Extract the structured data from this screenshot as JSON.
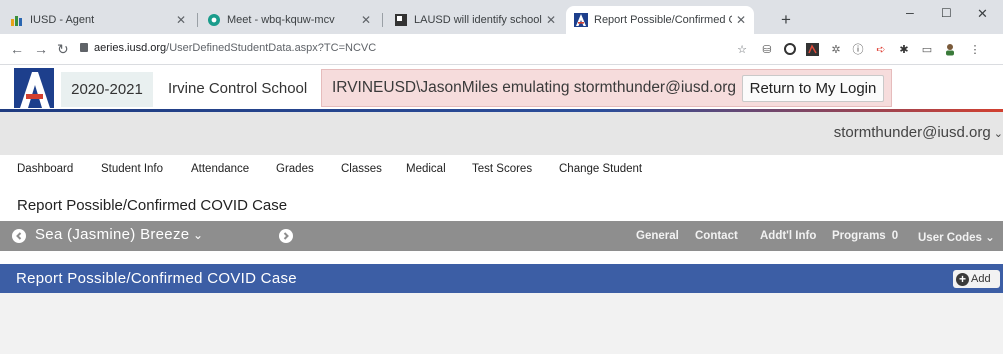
{
  "browser": {
    "tabs": [
      {
        "title": "IUSD - Agent",
        "favicon": "iusd-agent-icon",
        "active": false
      },
      {
        "title": "Meet - wbq-kquw-mcv",
        "favicon": "meet-icon",
        "active": false
      },
      {
        "title": "LAUSD will identify schools, class",
        "favicon": "news-icon",
        "active": false
      },
      {
        "title": "Report Possible/Confirmed COVI",
        "favicon": "aeries-icon",
        "active": true
      }
    ],
    "url_host": "aeries.iusd.org",
    "url_path": "/UserDefinedStudentData.aspx?TC=NCVC",
    "colors": {
      "tabstrip": "#dee1e6",
      "toolbar": "#ffffff"
    }
  },
  "header": {
    "school_year": "2020-2021",
    "school_name": "Irvine Control School",
    "emulating_text": "IRVINEUSD\\JasonMiles emulating stormthunder@iusd.org",
    "return_button": "Return to My Login",
    "user_email": "stormthunder@iusd.org",
    "colors": {
      "logo": "#1d3f8c",
      "emulating_bg": "#f6dcdc",
      "accent_red": "#d24030"
    }
  },
  "main_nav": {
    "items": [
      "Dashboard",
      "Student Info",
      "Attendance",
      "Grades",
      "Classes",
      "Medical",
      "Test Scores",
      "Change Student"
    ]
  },
  "page": {
    "title": "Report Possible/Confirmed COVID Case"
  },
  "student_bar": {
    "student_name": "Sea (Jasmine) Breeze",
    "tabs": [
      {
        "label": "General"
      },
      {
        "label": "Contact"
      },
      {
        "label": "Addt'l Info"
      },
      {
        "label": "Programs",
        "count": "0"
      },
      {
        "label": "User Codes"
      }
    ],
    "colors": {
      "background": "#8e8e8e"
    }
  },
  "section": {
    "title": "Report Possible/Confirmed COVID Case",
    "add_button": "Add",
    "colors": {
      "background": "#3c5ea5"
    }
  }
}
